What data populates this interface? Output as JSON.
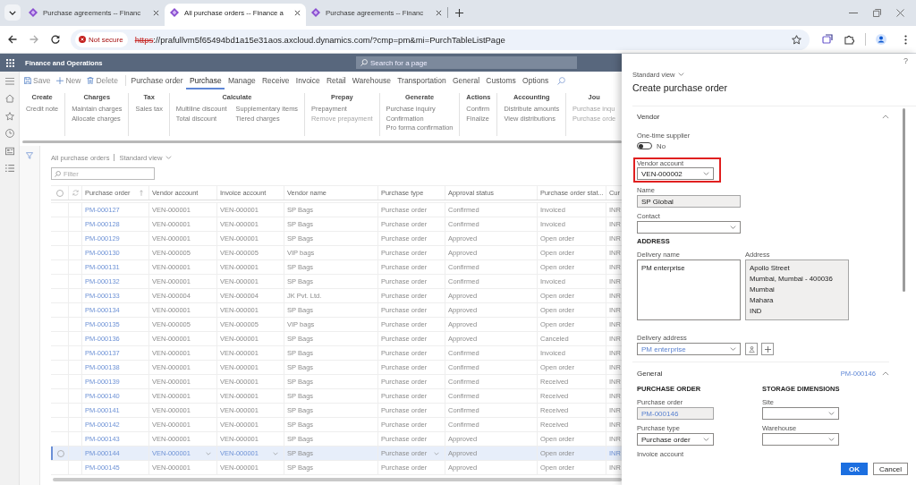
{
  "browser": {
    "tabs": [
      {
        "title": "Purchase agreements -- Financ",
        "selected": false
      },
      {
        "title": "All purchase orders -- Finance a",
        "selected": true
      },
      {
        "title": "Purchase agreements -- Financ",
        "selected": false
      }
    ],
    "security": "Not secure",
    "url_scheme": "https",
    "url_rest": "://prafullvm5f65494bd1a15e31aos.axcloud.dynamics.com/?cmp=pm&mi=PurchTableListPage"
  },
  "app_bar": {
    "title": "Finance and Operations",
    "search_placeholder": "Search for a page"
  },
  "action_pane": {
    "commands": [
      {
        "label": "Save",
        "kind": "save"
      },
      {
        "label": "New",
        "kind": "new"
      },
      {
        "label": "Delete",
        "kind": "delete"
      }
    ],
    "tabs": [
      {
        "label": "Purchase order",
        "selected": false
      },
      {
        "label": "Purchase",
        "selected": true
      },
      {
        "label": "Manage",
        "selected": false
      },
      {
        "label": "Receive",
        "selected": false
      },
      {
        "label": "Invoice",
        "selected": false
      },
      {
        "label": "Retail",
        "selected": false
      },
      {
        "label": "Warehouse",
        "selected": false
      },
      {
        "label": "Transportation",
        "selected": false
      },
      {
        "label": "General",
        "selected": false
      },
      {
        "label": "Customs",
        "selected": false
      },
      {
        "label": "Options",
        "selected": false
      }
    ]
  },
  "ribbon": {
    "groups": [
      {
        "title": "Create",
        "columns": [
          [
            {
              "label": "Credit note",
              "disabled": false
            }
          ]
        ]
      },
      {
        "title": "Charges",
        "columns": [
          [
            {
              "label": "Maintain charges",
              "disabled": false
            },
            {
              "label": "Allocate charges",
              "disabled": false
            }
          ]
        ]
      },
      {
        "title": "Tax",
        "columns": [
          [
            {
              "label": "Sales tax",
              "disabled": false
            }
          ]
        ]
      },
      {
        "title": "Calculate",
        "columns": [
          [
            {
              "label": "Multiline discount",
              "disabled": false
            },
            {
              "label": "Total discount",
              "disabled": false
            }
          ],
          [
            {
              "label": "Supplementary items",
              "disabled": false
            },
            {
              "label": "Tiered charges",
              "disabled": false
            }
          ]
        ]
      },
      {
        "title": "Prepay",
        "columns": [
          [
            {
              "label": "Prepayment",
              "disabled": false
            },
            {
              "label": "Remove prepayment",
              "disabled": true
            }
          ]
        ]
      },
      {
        "title": "Generate",
        "columns": [
          [
            {
              "label": "Purchase inquiry",
              "disabled": false
            },
            {
              "label": "Confirmation",
              "disabled": false
            },
            {
              "label": "Pro forma confirmation",
              "disabled": false
            }
          ]
        ]
      },
      {
        "title": "Actions",
        "columns": [
          [
            {
              "label": "Confirm",
              "disabled": false
            },
            {
              "label": "Finalize",
              "disabled": false
            }
          ]
        ]
      },
      {
        "title": "Accounting",
        "columns": [
          [
            {
              "label": "Distribute amounts",
              "disabled": false
            },
            {
              "label": "View distributions",
              "disabled": false
            }
          ]
        ]
      },
      {
        "title": "Jou",
        "columns": [
          [
            {
              "label": "Purchase inqu",
              "disabled": true
            },
            {
              "label": "Purchase orde",
              "disabled": true
            }
          ]
        ]
      }
    ]
  },
  "list": {
    "title": "All purchase orders",
    "view": "Standard view",
    "filter_placeholder": "Filter",
    "all_selected": false,
    "columns": [
      {
        "label": "Purchase order",
        "kind": "link",
        "sorted": true
      },
      {
        "label": "Vendor account",
        "kind": "account",
        "sorted": false
      },
      {
        "label": "Invoice account",
        "kind": "account",
        "sorted": false
      },
      {
        "label": "Vendor name",
        "kind": "text",
        "sorted": false
      },
      {
        "label": "Purchase type",
        "kind": "choice",
        "sorted": false
      },
      {
        "label": "Approval status",
        "kind": "text",
        "sorted": false
      },
      {
        "label": "Purchase order stat...",
        "kind": "text",
        "sorted": false
      },
      {
        "label": "Cur",
        "kind": "code",
        "sorted": false
      }
    ],
    "rows": [
      {
        "selected": false,
        "cells": [
          "PM-000127",
          "VEN-000001",
          "VEN-000001",
          "SP Bags",
          "Purchase order",
          "Confirmed",
          "Invoiced",
          "INR"
        ]
      },
      {
        "selected": false,
        "cells": [
          "PM-000128",
          "VEN-000001",
          "VEN-000001",
          "SP Bags",
          "Purchase order",
          "Confirmed",
          "Invoiced",
          "INR"
        ]
      },
      {
        "selected": false,
        "cells": [
          "PM-000129",
          "VEN-000001",
          "VEN-000001",
          "SP Bags",
          "Purchase order",
          "Approved",
          "Open order",
          "INR"
        ]
      },
      {
        "selected": false,
        "cells": [
          "PM-000130",
          "VEN-000005",
          "VEN-000005",
          "VIP bags",
          "Purchase order",
          "Approved",
          "Open order",
          "INR"
        ]
      },
      {
        "selected": false,
        "cells": [
          "PM-000131",
          "VEN-000001",
          "VEN-000001",
          "SP Bags",
          "Purchase order",
          "Confirmed",
          "Open order",
          "INR"
        ]
      },
      {
        "selected": false,
        "cells": [
          "PM-000132",
          "VEN-000001",
          "VEN-000001",
          "SP Bags",
          "Purchase order",
          "Confirmed",
          "Invoiced",
          "INR"
        ]
      },
      {
        "selected": false,
        "cells": [
          "PM-000133",
          "VEN-000004",
          "VEN-000004",
          "JK Pvt. Ltd.",
          "Purchase order",
          "Approved",
          "Open order",
          "INR"
        ]
      },
      {
        "selected": false,
        "cells": [
          "PM-000134",
          "VEN-000001",
          "VEN-000001",
          "SP Bags",
          "Purchase order",
          "Approved",
          "Open order",
          "INR"
        ]
      },
      {
        "selected": false,
        "cells": [
          "PM-000135",
          "VEN-000005",
          "VEN-000005",
          "VIP bags",
          "Purchase order",
          "Approved",
          "Open order",
          "INR"
        ]
      },
      {
        "selected": false,
        "cells": [
          "PM-000136",
          "VEN-000001",
          "VEN-000001",
          "SP Bags",
          "Purchase order",
          "Approved",
          "Canceled",
          "INR"
        ]
      },
      {
        "selected": false,
        "cells": [
          "PM-000137",
          "VEN-000001",
          "VEN-000001",
          "SP Bags",
          "Purchase order",
          "Confirmed",
          "Invoiced",
          "INR"
        ]
      },
      {
        "selected": false,
        "cells": [
          "PM-000138",
          "VEN-000001",
          "VEN-000001",
          "SP Bags",
          "Purchase order",
          "Confirmed",
          "Open order",
          "INR"
        ]
      },
      {
        "selected": false,
        "cells": [
          "PM-000139",
          "VEN-000001",
          "VEN-000001",
          "SP Bags",
          "Purchase order",
          "Confirmed",
          "Received",
          "INR"
        ]
      },
      {
        "selected": false,
        "cells": [
          "PM-000140",
          "VEN-000001",
          "VEN-000001",
          "SP Bags",
          "Purchase order",
          "Confirmed",
          "Received",
          "INR"
        ]
      },
      {
        "selected": false,
        "cells": [
          "PM-000141",
          "VEN-000001",
          "VEN-000001",
          "SP Bags",
          "Purchase order",
          "Confirmed",
          "Received",
          "INR"
        ]
      },
      {
        "selected": false,
        "cells": [
          "PM-000142",
          "VEN-000001",
          "VEN-000001",
          "SP Bags",
          "Purchase order",
          "Confirmed",
          "Received",
          "INR"
        ]
      },
      {
        "selected": false,
        "cells": [
          "PM-000143",
          "VEN-000001",
          "VEN-000001",
          "SP Bags",
          "Purchase order",
          "Approved",
          "Open order",
          "INR"
        ]
      },
      {
        "selected": true,
        "cells": [
          "PM-000144",
          "VEN-000001",
          "VEN-000001",
          "SP Bags",
          "Purchase order",
          "Approved",
          "Open order",
          "INR"
        ]
      },
      {
        "selected": false,
        "cells": [
          "PM-000145",
          "VEN-000001",
          "VEN-000001",
          "SP Bags",
          "Purchase order",
          "Approved",
          "Open order",
          "INR"
        ]
      }
    ]
  },
  "panel": {
    "help": "?",
    "view": "Standard view",
    "title": "Create purchase order",
    "vendor": {
      "title": "Vendor",
      "expanded": true,
      "one_time_supplier": {
        "label": "One-time supplier",
        "on": false,
        "value": "No"
      },
      "vendor_account": {
        "label": "Vendor account",
        "value": "VEN-000002",
        "highlighted": true
      },
      "name": {
        "label": "Name",
        "value": "SP Global"
      },
      "contact": {
        "label": "Contact"
      },
      "address_heading": "ADDRESS",
      "delivery_name": {
        "label": "Delivery name",
        "value": "PM enterprise"
      },
      "address": {
        "label": "Address",
        "lines": [
          "Apollo Street",
          "Mumbai, Mumbai - 400036",
          "Mumbai",
          "Mahara",
          "IND"
        ]
      },
      "delivery_address": {
        "label": "Delivery address",
        "value": "PM enterprise"
      }
    },
    "general": {
      "title": "General",
      "summary": "PM-000146",
      "expanded": true,
      "columns": [
        {
          "heading": "PURCHASE ORDER",
          "fields": [
            {
              "label": "Purchase order",
              "value": "PM-000146",
              "kind": "link"
            },
            {
              "label": "Purchase type",
              "value": "Purchase order",
              "kind": "dropdown"
            },
            {
              "label": "Invoice account",
              "kind": "label"
            }
          ]
        },
        {
          "heading": "STORAGE DIMENSIONS",
          "fields": [
            {
              "label": "Site",
              "kind": "dropdown"
            },
            {
              "label": "Warehouse",
              "kind": "dropdown"
            }
          ]
        }
      ]
    },
    "buttons": [
      {
        "label": "OK",
        "kind": "primary"
      },
      {
        "label": "Cancel",
        "kind": "secondary"
      }
    ]
  }
}
